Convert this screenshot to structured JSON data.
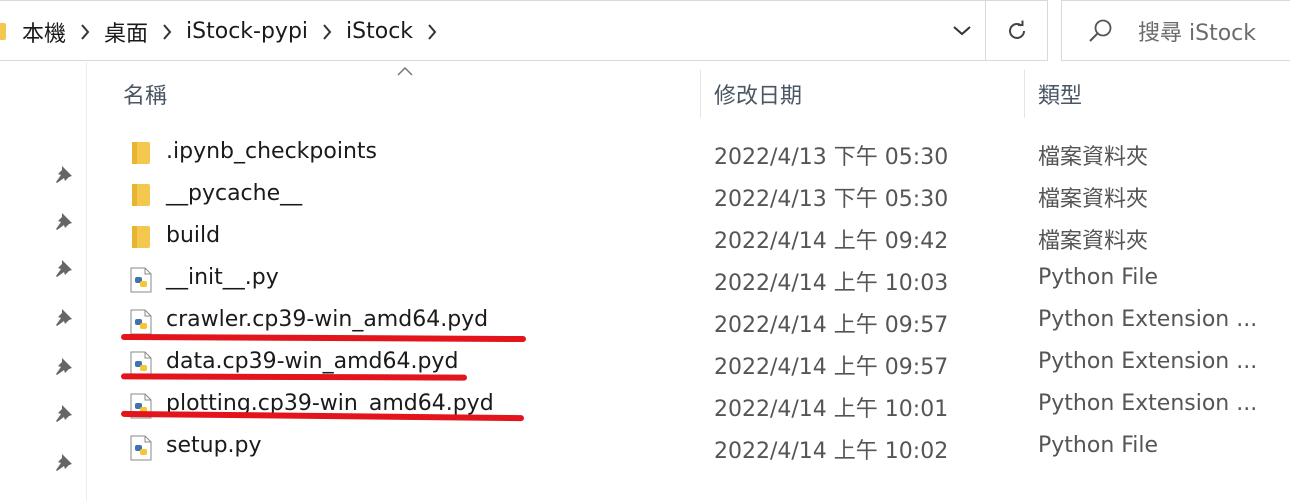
{
  "breadcrumb": {
    "items": [
      "本機",
      "桌面",
      "iStock-pypi",
      "iStock"
    ]
  },
  "search": {
    "placeholder": "搜尋 iStock"
  },
  "columns": {
    "name": "名稱",
    "date": "修改日期",
    "type": "類型"
  },
  "files": [
    {
      "name": ".ipynb_checkpoints",
      "date": "2022/4/13 下午 05:30",
      "type": "檔案資料夾",
      "icon": "folder-icon"
    },
    {
      "name": "__pycache__",
      "date": "2022/4/13 下午 05:30",
      "type": "檔案資料夾",
      "icon": "folder-icon"
    },
    {
      "name": "build",
      "date": "2022/4/14 上午 09:42",
      "type": "檔案資料夾",
      "icon": "folder-icon"
    },
    {
      "name": "__init__.py",
      "date": "2022/4/14 上午 10:03",
      "type": "Python File",
      "icon": "python-file-icon"
    },
    {
      "name": "crawler.cp39-win_amd64.pyd",
      "date": "2022/4/14 上午 09:57",
      "type": "Python Extension ...",
      "icon": "python-file-icon",
      "highlighted": true
    },
    {
      "name": "data.cp39-win_amd64.pyd",
      "date": "2022/4/14 上午 09:57",
      "type": "Python Extension ...",
      "icon": "python-file-icon",
      "highlighted": true
    },
    {
      "name": "plotting.cp39-win_amd64.pyd",
      "date": "2022/4/14 上午 10:01",
      "type": "Python Extension ...",
      "icon": "python-file-icon",
      "highlighted": true
    },
    {
      "name": "setup.py",
      "date": "2022/4/14 上午 10:02",
      "type": "Python File",
      "icon": "python-file-icon"
    }
  ],
  "colors": {
    "annotation": "#e3141b",
    "folder": "#f4c74f"
  }
}
